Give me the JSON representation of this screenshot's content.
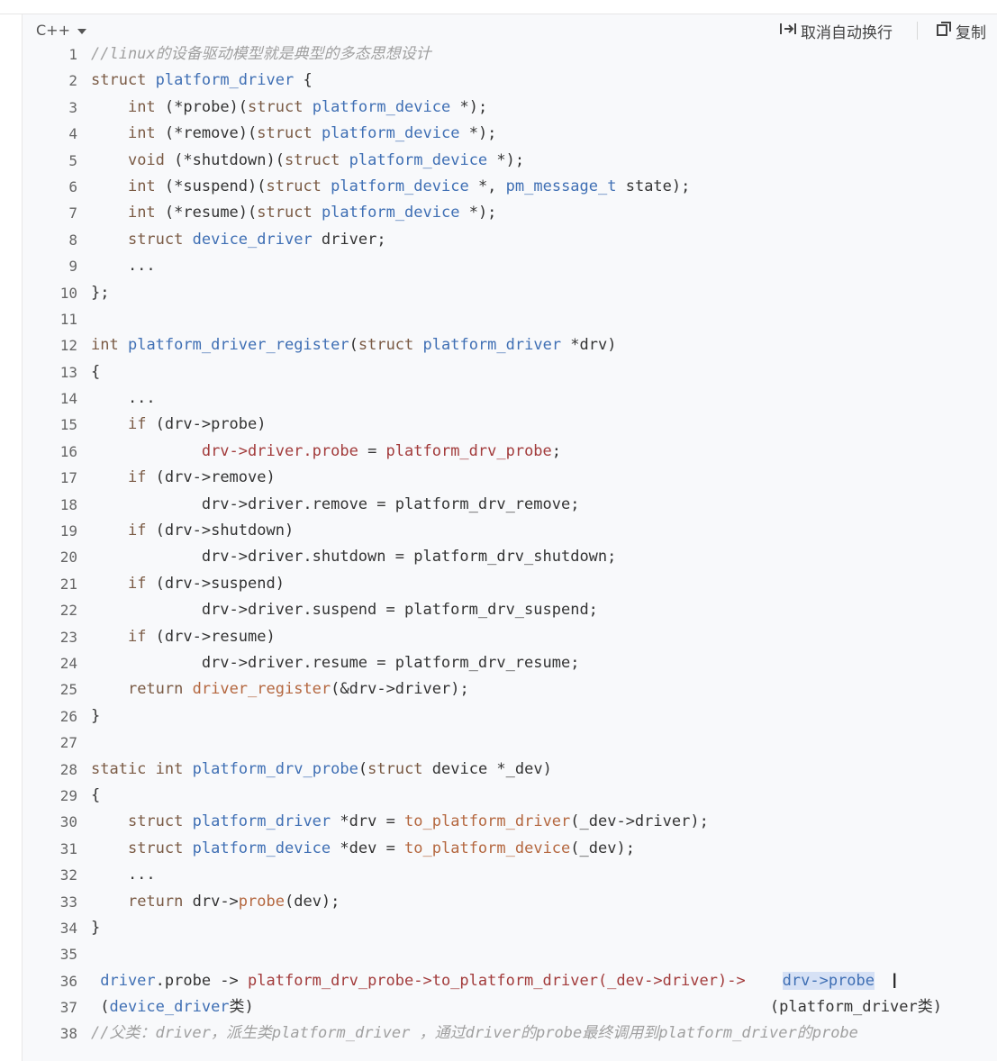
{
  "toolbar": {
    "language": "C++",
    "wrap_label": "取消自动换行",
    "copy_label": "复制"
  },
  "lines": [
    {
      "n": "1",
      "t": "//linux的设备驱动模型就是典型的多态思想设计"
    },
    {
      "n": "2",
      "t": "struct platform_driver {"
    },
    {
      "n": "3",
      "t": "    int (*probe)(struct platform_device *);"
    },
    {
      "n": "4",
      "t": "    int (*remove)(struct platform_device *);"
    },
    {
      "n": "5",
      "t": "    void (*shutdown)(struct platform_device *);"
    },
    {
      "n": "6",
      "t": "    int (*suspend)(struct platform_device *, pm_message_t state);"
    },
    {
      "n": "7",
      "t": "    int (*resume)(struct platform_device *);"
    },
    {
      "n": "8",
      "t": "    struct device_driver driver;"
    },
    {
      "n": "9",
      "t": "    ..."
    },
    {
      "n": "10",
      "t": "};"
    },
    {
      "n": "11",
      "t": ""
    },
    {
      "n": "12",
      "t": "int platform_driver_register(struct platform_driver *drv)"
    },
    {
      "n": "13",
      "t": "{"
    },
    {
      "n": "14",
      "t": "    ..."
    },
    {
      "n": "15",
      "t": "    if (drv->probe)"
    },
    {
      "n": "16",
      "t": "            drv->driver.probe = platform_drv_probe;"
    },
    {
      "n": "17",
      "t": "    if (drv->remove)"
    },
    {
      "n": "18",
      "t": "            drv->driver.remove = platform_drv_remove;"
    },
    {
      "n": "19",
      "t": "    if (drv->shutdown)"
    },
    {
      "n": "20",
      "t": "            drv->driver.shutdown = platform_drv_shutdown;"
    },
    {
      "n": "21",
      "t": "    if (drv->suspend)"
    },
    {
      "n": "22",
      "t": "            drv->driver.suspend = platform_drv_suspend;"
    },
    {
      "n": "23",
      "t": "    if (drv->resume)"
    },
    {
      "n": "24",
      "t": "            drv->driver.resume = platform_drv_resume;"
    },
    {
      "n": "25",
      "t": "    return driver_register(&drv->driver);"
    },
    {
      "n": "26",
      "t": "}"
    },
    {
      "n": "27",
      "t": ""
    },
    {
      "n": "28",
      "t": "static int platform_drv_probe(struct device *_dev)"
    },
    {
      "n": "29",
      "t": "{"
    },
    {
      "n": "30",
      "t": "    struct platform_driver *drv = to_platform_driver(_dev->driver);"
    },
    {
      "n": "31",
      "t": "    struct platform_device *dev = to_platform_device(_dev);"
    },
    {
      "n": "32",
      "t": "    ..."
    },
    {
      "n": "33",
      "t": "    return drv->probe(dev);"
    },
    {
      "n": "34",
      "t": "}"
    },
    {
      "n": "35",
      "t": ""
    },
    {
      "n": "36",
      "t": " driver.probe -> platform_drv_probe->to_platform_driver(_dev->driver)->    drv->probe"
    },
    {
      "n": "37",
      "t": " (device_driver类)                                                        (platform_driver类)"
    },
    {
      "n": "38",
      "t": "//父类：driver，派生类platform_driver ，通过driver的probe最终调用到platform_driver的probe"
    }
  ]
}
